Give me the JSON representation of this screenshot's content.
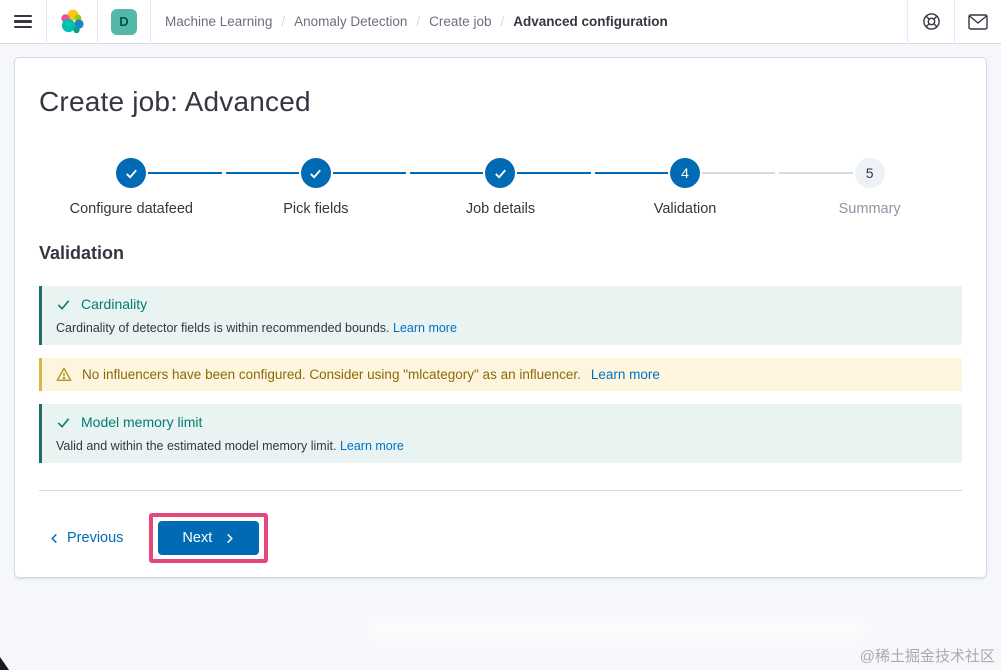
{
  "header": {
    "space_badge": "D",
    "breadcrumbs": [
      {
        "label": "Machine Learning"
      },
      {
        "label": "Anomaly Detection"
      },
      {
        "label": "Create job"
      },
      {
        "label": "Advanced configuration"
      }
    ],
    "separator": "/"
  },
  "page": {
    "title": "Create job: Advanced",
    "section_heading": "Validation"
  },
  "stepper": {
    "steps": [
      {
        "label": "Configure datafeed",
        "status": "complete"
      },
      {
        "label": "Pick fields",
        "status": "complete"
      },
      {
        "label": "Job details",
        "status": "complete"
      },
      {
        "label": "Validation",
        "status": "current",
        "number": "4"
      },
      {
        "label": "Summary",
        "status": "incomplete",
        "number": "5"
      }
    ]
  },
  "callouts": [
    {
      "type": "success",
      "title": "Cardinality",
      "body": "Cardinality of detector fields is within recommended bounds.",
      "link": "Learn more"
    },
    {
      "type": "warning",
      "body": "No influencers have been configured. Consider using \"mlcategory\" as an influencer.",
      "link": "Learn more"
    },
    {
      "type": "success",
      "title": "Model memory limit",
      "body": "Valid and within the estimated model memory limit.",
      "link": "Learn more"
    }
  ],
  "footer_nav": {
    "previous_label": "Previous",
    "next_label": "Next"
  },
  "watermark": "@稀土掘金技术社区",
  "colors": {
    "primary": "#006bb4",
    "success": "#017d73",
    "warning": "#8a6a0a",
    "annotation_highlight": "#e5467d",
    "space_badge_bg": "#54b8a6"
  }
}
